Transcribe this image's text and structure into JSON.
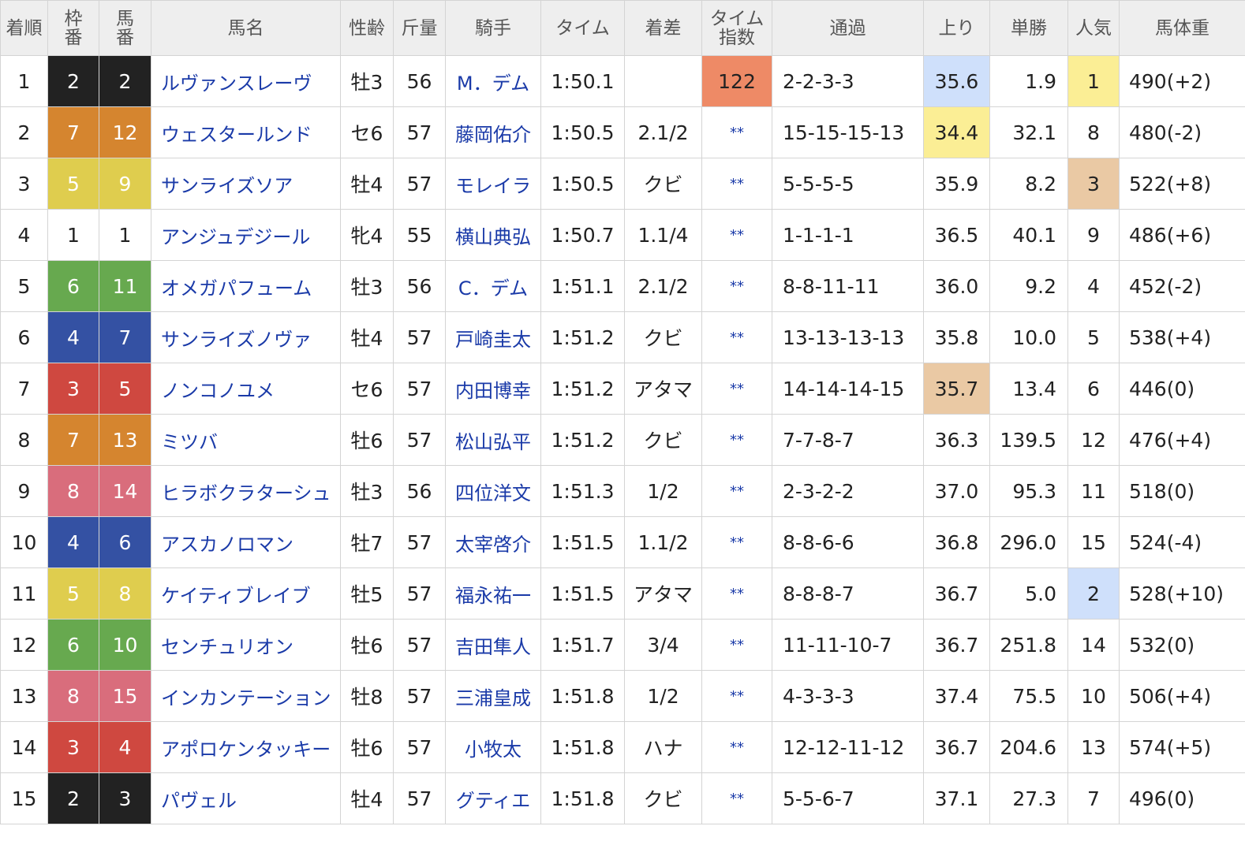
{
  "colors": {
    "waku": {
      "1": "#ffffff",
      "2": "#222222",
      "3": "#cf4840",
      "4": "#3451a3",
      "5": "#dfcd4e",
      "6": "#67a94f",
      "7": "#d5852f",
      "8": "#d96d7c"
    },
    "waku_text": {
      "1": "#222222"
    },
    "highlight_first": "#fbee95",
    "highlight_second": "#cfe0fb",
    "highlight_third": "#eac9a4",
    "time_index_highlight": "#ee8a66",
    "link": "#1a3aa8"
  },
  "headers": {
    "rank": "着順",
    "waku_top": "枠",
    "waku_bottom": "番",
    "num_top": "馬",
    "num_bottom": "番",
    "name": "馬名",
    "sexage": "性齢",
    "weight_carried": "斤量",
    "jockey": "騎手",
    "time": "タイム",
    "margin": "着差",
    "time_index_top": "タイム",
    "time_index_bottom": "指数",
    "passing": "通過",
    "last3f": "上り",
    "odds": "単勝",
    "popularity": "人気",
    "body_weight": "馬体重"
  },
  "rows": [
    {
      "rank": "1",
      "waku": "2",
      "num": "2",
      "name": "ルヴァンスレーヴ",
      "sexage": "牡3",
      "kg": "56",
      "jockey": "M．デム",
      "time": "1:50.1",
      "margin": "",
      "ti": "122",
      "ti_hl": true,
      "pass": "2-2-3-3",
      "last3f": "35.6",
      "last3f_hl": "b",
      "odds": "1.9",
      "pop": "1",
      "pop_hl": "y",
      "bw": "490(+2)"
    },
    {
      "rank": "2",
      "waku": "7",
      "num": "12",
      "name": "ウェスタールンド",
      "sexage": "セ6",
      "kg": "57",
      "jockey": "藤岡佑介",
      "time": "1:50.5",
      "margin": "2.1/2",
      "ti": "**",
      "pass": "15-15-15-13",
      "last3f": "34.4",
      "last3f_hl": "y",
      "odds": "32.1",
      "pop": "8",
      "bw": "480(-2)"
    },
    {
      "rank": "3",
      "waku": "5",
      "num": "9",
      "name": "サンライズソア",
      "sexage": "牡4",
      "kg": "57",
      "jockey": "モレイラ",
      "time": "1:50.5",
      "margin": "クビ",
      "ti": "**",
      "pass": "5-5-5-5",
      "last3f": "35.9",
      "odds": "8.2",
      "pop": "3",
      "pop_hl": "o",
      "bw": "522(+8)"
    },
    {
      "rank": "4",
      "waku": "1",
      "num": "1",
      "name": "アンジュデジール",
      "sexage": "牝4",
      "kg": "55",
      "jockey": "横山典弘",
      "time": "1:50.7",
      "margin": "1.1/4",
      "ti": "**",
      "pass": "1-1-1-1",
      "last3f": "36.5",
      "odds": "40.1",
      "pop": "9",
      "bw": "486(+6)"
    },
    {
      "rank": "5",
      "waku": "6",
      "num": "11",
      "name": "オメガパフューム",
      "sexage": "牡3",
      "kg": "56",
      "jockey": "C．デム",
      "time": "1:51.1",
      "margin": "2.1/2",
      "ti": "**",
      "pass": "8-8-11-11",
      "last3f": "36.0",
      "odds": "9.2",
      "pop": "4",
      "bw": "452(-2)"
    },
    {
      "rank": "6",
      "waku": "4",
      "num": "7",
      "name": "サンライズノヴァ",
      "sexage": "牡4",
      "kg": "57",
      "jockey": "戸崎圭太",
      "time": "1:51.2",
      "margin": "クビ",
      "ti": "**",
      "pass": "13-13-13-13",
      "last3f": "35.8",
      "odds": "10.0",
      "pop": "5",
      "bw": "538(+4)"
    },
    {
      "rank": "7",
      "waku": "3",
      "num": "5",
      "name": "ノンコノユメ",
      "sexage": "セ6",
      "kg": "57",
      "jockey": "内田博幸",
      "time": "1:51.2",
      "margin": "アタマ",
      "ti": "**",
      "pass": "14-14-14-15",
      "last3f": "35.7",
      "last3f_hl": "o",
      "odds": "13.4",
      "pop": "6",
      "bw": "446(0)"
    },
    {
      "rank": "8",
      "waku": "7",
      "num": "13",
      "name": "ミツバ",
      "sexage": "牡6",
      "kg": "57",
      "jockey": "松山弘平",
      "time": "1:51.2",
      "margin": "クビ",
      "ti": "**",
      "pass": "7-7-8-7",
      "last3f": "36.3",
      "odds": "139.5",
      "pop": "12",
      "bw": "476(+4)"
    },
    {
      "rank": "9",
      "waku": "8",
      "num": "14",
      "name": "ヒラボクラターシュ",
      "sexage": "牡3",
      "kg": "56",
      "jockey": "四位洋文",
      "time": "1:51.3",
      "margin": "1/2",
      "ti": "**",
      "pass": "2-3-2-2",
      "last3f": "37.0",
      "odds": "95.3",
      "pop": "11",
      "bw": "518(0)"
    },
    {
      "rank": "10",
      "waku": "4",
      "num": "6",
      "name": "アスカノロマン",
      "sexage": "牡7",
      "kg": "57",
      "jockey": "太宰啓介",
      "time": "1:51.5",
      "margin": "1.1/2",
      "ti": "**",
      "pass": "8-8-6-6",
      "last3f": "36.8",
      "odds": "296.0",
      "pop": "15",
      "bw": "524(-4)"
    },
    {
      "rank": "11",
      "waku": "5",
      "num": "8",
      "name": "ケイティブレイブ",
      "sexage": "牡5",
      "kg": "57",
      "jockey": "福永祐一",
      "time": "1:51.5",
      "margin": "アタマ",
      "ti": "**",
      "pass": "8-8-8-7",
      "last3f": "36.7",
      "odds": "5.0",
      "pop": "2",
      "pop_hl": "b",
      "bw": "528(+10)"
    },
    {
      "rank": "12",
      "waku": "6",
      "num": "10",
      "name": "センチュリオン",
      "sexage": "牡6",
      "kg": "57",
      "jockey": "吉田隼人",
      "time": "1:51.7",
      "margin": "3/4",
      "ti": "**",
      "pass": "11-11-10-7",
      "last3f": "36.7",
      "odds": "251.8",
      "pop": "14",
      "bw": "532(0)"
    },
    {
      "rank": "13",
      "waku": "8",
      "num": "15",
      "name": "インカンテーション",
      "sexage": "牡8",
      "kg": "57",
      "jockey": "三浦皇成",
      "time": "1:51.8",
      "margin": "1/2",
      "ti": "**",
      "pass": "4-3-3-3",
      "last3f": "37.4",
      "odds": "75.5",
      "pop": "10",
      "bw": "506(+4)"
    },
    {
      "rank": "14",
      "waku": "3",
      "num": "4",
      "name": "アポロケンタッキー",
      "sexage": "牡6",
      "kg": "57",
      "jockey": "小牧太",
      "time": "1:51.8",
      "margin": "ハナ",
      "ti": "**",
      "pass": "12-12-11-12",
      "last3f": "36.7",
      "odds": "204.6",
      "pop": "13",
      "bw": "574(+5)"
    },
    {
      "rank": "15",
      "waku": "2",
      "num": "3",
      "name": "パヴェル",
      "sexage": "牡4",
      "kg": "57",
      "jockey": "グティエ",
      "time": "1:51.8",
      "margin": "クビ",
      "ti": "**",
      "pass": "5-5-6-7",
      "last3f": "37.1",
      "odds": "27.3",
      "pop": "7",
      "bw": "496(0)"
    }
  ]
}
